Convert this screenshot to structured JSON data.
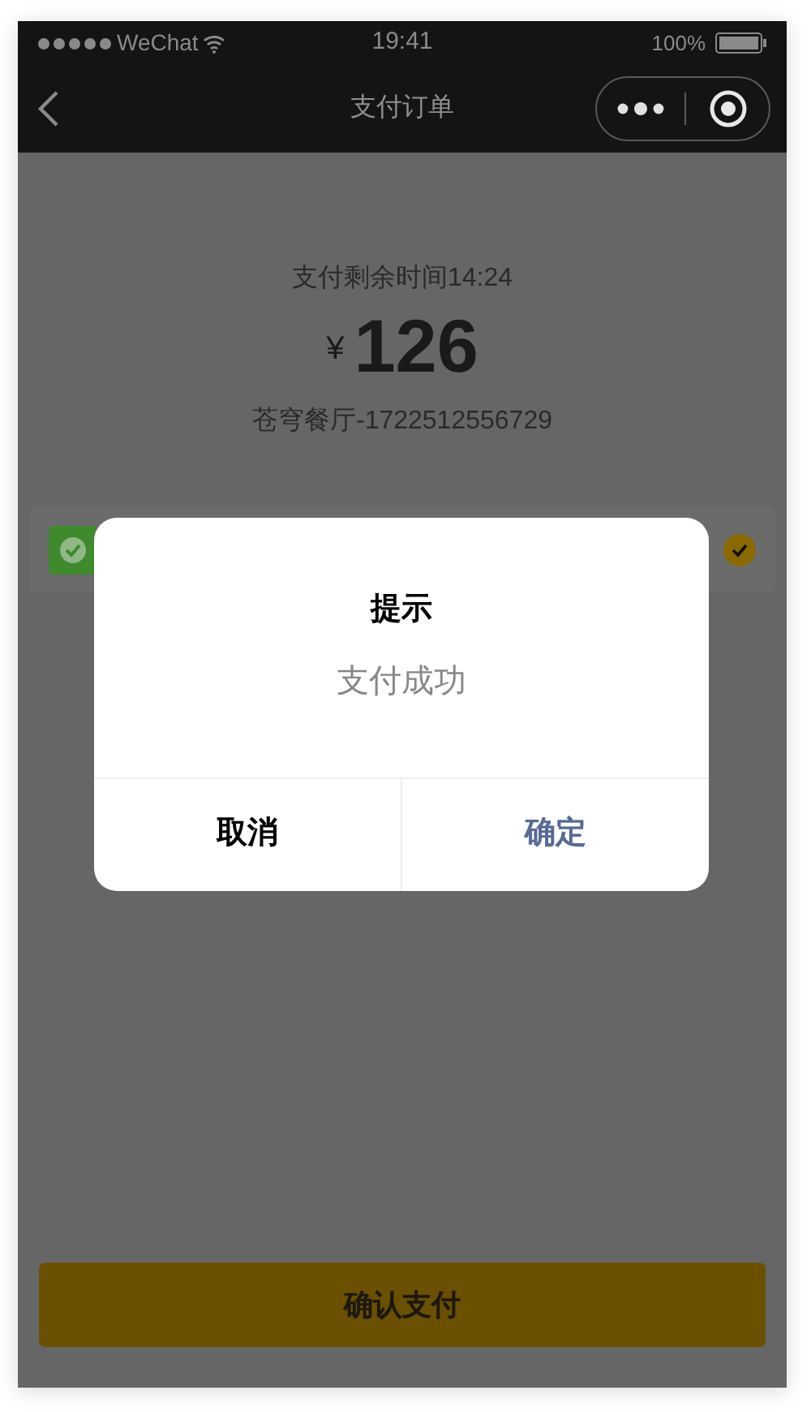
{
  "status_bar": {
    "carrier": "WeChat",
    "time": "19:41",
    "battery": "100%"
  },
  "nav": {
    "title": "支付订单"
  },
  "order": {
    "countdown": "支付剩余时间14:24",
    "currency": "¥",
    "amount": "126",
    "merchant": "苍穹餐厅-1722512556729"
  },
  "payment_method": {
    "selected": true
  },
  "submit_button": "确认支付",
  "dialog": {
    "title": "提示",
    "message": "支付成功",
    "buttons": [
      {
        "label": "取消",
        "kind": "cancel"
      },
      {
        "label": "确定",
        "kind": "confirm"
      }
    ]
  }
}
